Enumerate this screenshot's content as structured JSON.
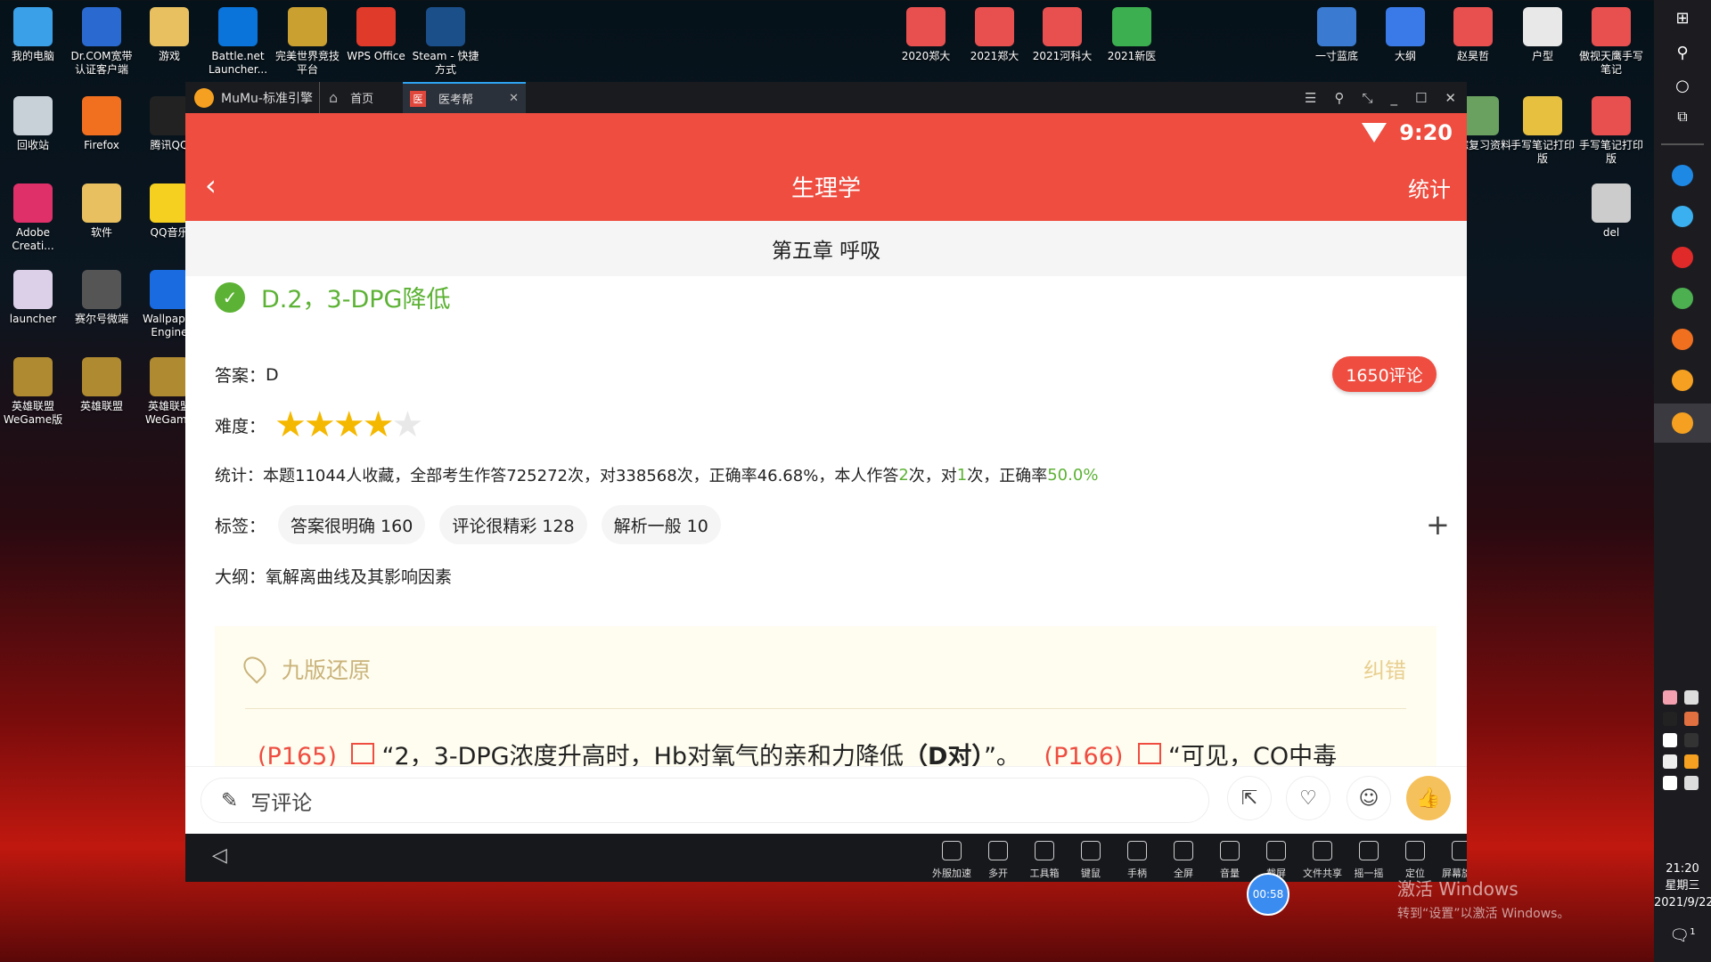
{
  "desktop": {
    "left": [
      {
        "label": "我的电脑",
        "icon": "computer-icon",
        "color": "#3aa0e8"
      },
      {
        "label": "Dr.COM宽带认证客户端",
        "icon": "network-icon",
        "color": "#2a6ad0"
      },
      {
        "label": "游戏",
        "icon": "folder-icon",
        "color": "#e8c060"
      },
      {
        "label": "Battle.net Launcher...",
        "icon": "battlenet-icon",
        "color": "#0a74da"
      },
      {
        "label": "完美世界竞技平台",
        "icon": "perfectworld-icon",
        "color": "#caa030"
      },
      {
        "label": "WPS Office",
        "icon": "wps-icon",
        "color": "#e03a2a"
      },
      {
        "label": "Steam - 快捷方式",
        "icon": "steam-icon",
        "color": "#1b4f8a"
      },
      {
        "label": "回收站",
        "icon": "recycle-bin-icon",
        "color": "#c8d0d8"
      },
      {
        "label": "Firefox",
        "icon": "firefox-icon",
        "color": "#f07020"
      },
      {
        "label": "腾讯QQ",
        "icon": "qq-icon",
        "color": "#222"
      },
      {
        "label": "Adobe Creati...",
        "icon": "adobe-cc-icon",
        "color": "#e0306a"
      },
      {
        "label": "软件",
        "icon": "folder-icon",
        "color": "#e8c060"
      },
      {
        "label": "QQ音乐",
        "icon": "qqmusic-icon",
        "color": "#f5d020"
      },
      {
        "label": "launcher",
        "icon": "genshin-launcher-icon",
        "color": "#dcd0e8"
      },
      {
        "label": "赛尔号微端",
        "icon": "seer-icon",
        "color": "#555"
      },
      {
        "label": "Wallpaper Engine",
        "icon": "wallpaper-engine-icon",
        "color": "#1a6ae0"
      },
      {
        "label": "英雄联盟WeGame版",
        "icon": "lol-icon",
        "color": "#b08a30"
      },
      {
        "label": "英雄联盟",
        "icon": "lol-icon",
        "color": "#b08a30"
      },
      {
        "label": "英雄联盟WeGame",
        "icon": "lol-icon",
        "color": "#b08a30"
      }
    ],
    "right": [
      {
        "label": "2020郑大",
        "icon": "pdf-icon",
        "color": "#e85050"
      },
      {
        "label": "2021郑大",
        "icon": "pdf-icon",
        "color": "#e85050"
      },
      {
        "label": "2021河科大",
        "icon": "pdf-icon",
        "color": "#e85050"
      },
      {
        "label": "2021新医",
        "icon": "spreadsheet-icon",
        "color": "#3cb050"
      },
      {
        "label": "一寸蓝底",
        "icon": "photo-icon",
        "color": "#3a7ad0"
      },
      {
        "label": "大纲",
        "icon": "word-icon",
        "color": "#3a7ae8"
      },
      {
        "label": "赵昊哲",
        "icon": "pdf-icon",
        "color": "#e85050"
      },
      {
        "label": "户型",
        "icon": "image-icon",
        "color": "#e8e8e8"
      },
      {
        "label": "傲视天鹰手写笔记",
        "icon": "pdf-icon",
        "color": "#e85050"
      },
      {
        "label": "西综复习资料",
        "icon": "archive-icon",
        "color": "#6aa060"
      },
      {
        "label": "手写笔记打印版",
        "icon": "zip-folder-icon",
        "color": "#e8c040"
      },
      {
        "label": "手写笔记打印版",
        "icon": "pdf-icon",
        "color": "#e85050"
      },
      {
        "label": "del",
        "icon": "settings-file-icon",
        "color": "#ccc"
      }
    ]
  },
  "emulator": {
    "app_name": "MuMu-标准引擎",
    "home_tab": "首页",
    "active_tab": "医考帮",
    "active_tab_badge": "医",
    "controls": [
      "menu-icon",
      "pin-icon",
      "resize-icon",
      "minimize-icon",
      "maximize-icon",
      "close-icon"
    ]
  },
  "status": {
    "time": "9:20"
  },
  "header": {
    "title": "生理学",
    "right_action": "统计"
  },
  "chapter": "第五章 呼吸",
  "question": {
    "correct_option": "D.2，3-DPG降低",
    "answer_label": "答案：",
    "answer": "D",
    "comments_badge": "1650评论",
    "difficulty_label": "难度：",
    "difficulty_stars": 4,
    "difficulty_max": 5,
    "stats_label": "统计：",
    "stats": {
      "s1": "本题11044人收藏，全部考生作答725272次，对338568次，正确率46.68%，本人作答",
      "my_answers": "2",
      "s2": "次，对",
      "my_correct": "1",
      "s3": "次，正确率",
      "my_rate": "50.0%"
    },
    "tags_label": "标签：",
    "tags": [
      "答案很明确 160",
      "评论很精彩 128",
      "解析一般 10"
    ],
    "outline_label": "大纲：",
    "outline": "氧解离曲线及其影响因素"
  },
  "explanation": {
    "title": "九版还原",
    "correct_action": "纠错",
    "ref1": "(P165)",
    "quote1": "“2，3-DPG浓度升高时，Hb对氧气的亲和力降低",
    "bold1": "（D对）",
    "q1end": "”。",
    "ref2": "(P166)",
    "quote2": "“可见，CO中毒"
  },
  "comment_bar": {
    "placeholder": "写评论"
  },
  "nav_tools": [
    "外服加速",
    "多开",
    "工具箱",
    "键鼠",
    "手柄",
    "全屏",
    "音量",
    "截屏",
    "文件共享",
    "摇一摇",
    "定位",
    "屏幕旋转"
  ],
  "timer": "00:58",
  "watermark": {
    "title": "激活 Windows",
    "subtitle": "转到“设置”以激活 Windows。"
  },
  "clock": {
    "time": "21:20",
    "weekday": "星期三",
    "date": "2021/9/22"
  },
  "notification_count": "1",
  "colors": {
    "accent": "#ee4d40",
    "correct": "#5cb234",
    "star": "#f5b800",
    "explain": "#c9b37a",
    "like": "#f5c15c"
  }
}
